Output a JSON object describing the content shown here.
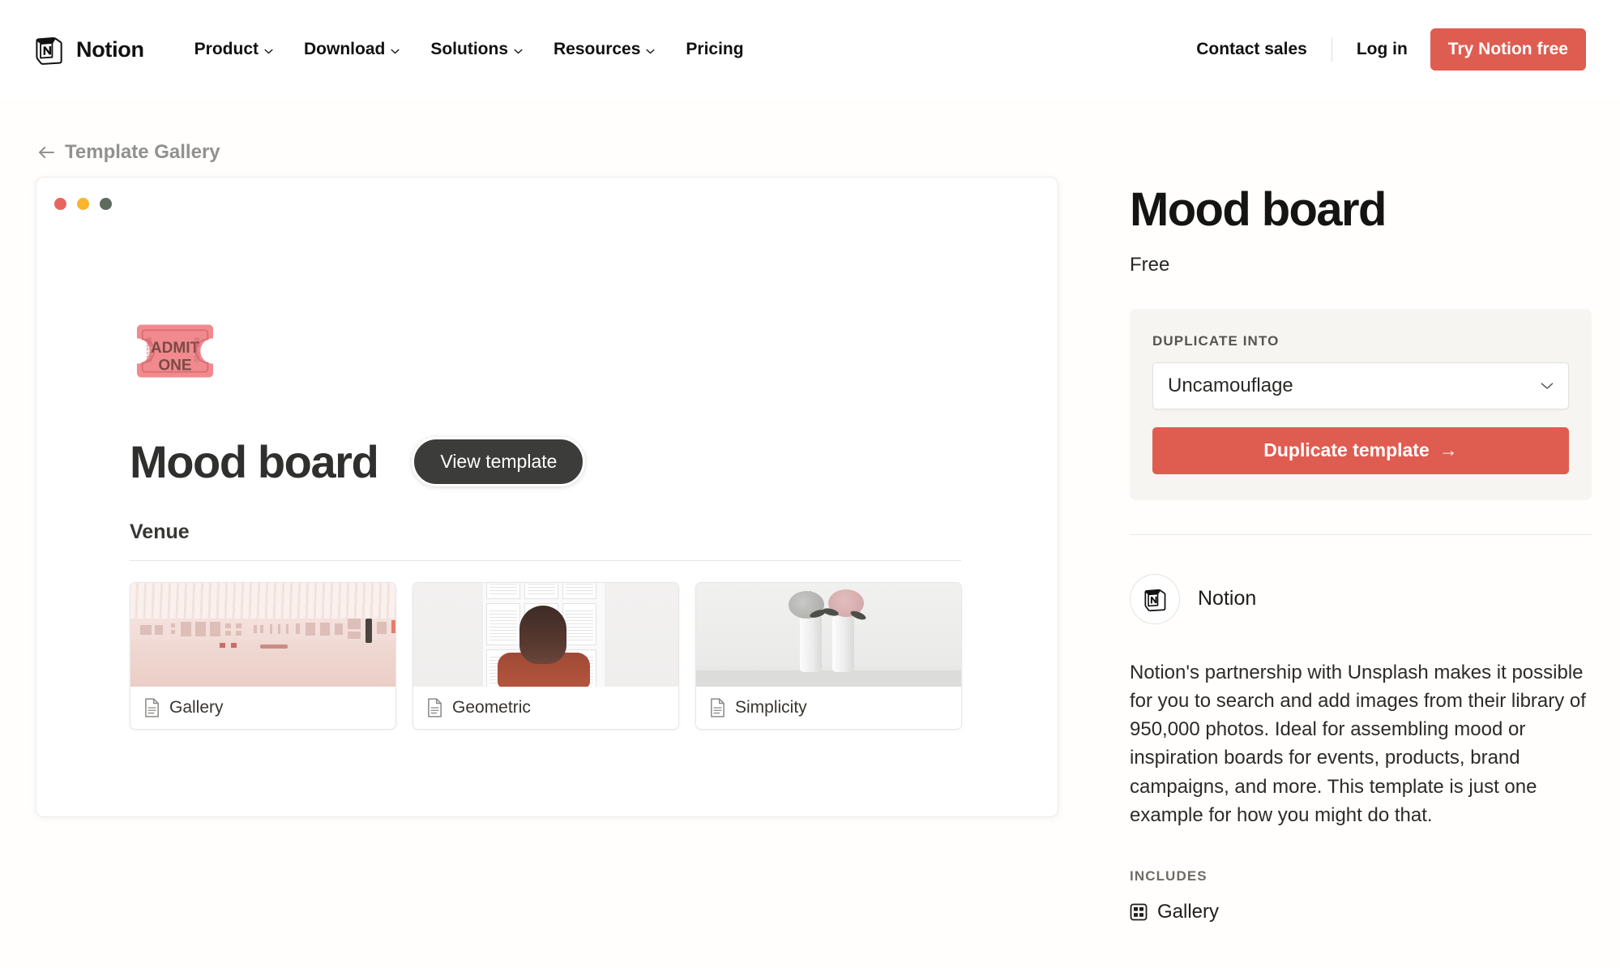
{
  "header": {
    "brand": "Notion",
    "nav": [
      {
        "label": "Product",
        "has_caret": true
      },
      {
        "label": "Download",
        "has_caret": true
      },
      {
        "label": "Solutions",
        "has_caret": true
      },
      {
        "label": "Resources",
        "has_caret": true
      },
      {
        "label": "Pricing",
        "has_caret": false
      }
    ],
    "contact_sales": "Contact sales",
    "log_in": "Log in",
    "cta": "Try Notion free",
    "cta_color": "#DF5C51"
  },
  "breadcrumb": {
    "label": "Template Gallery",
    "icon": "arrow-left-icon"
  },
  "preview": {
    "window_dots": [
      "#E8655F",
      "#F8B62C",
      "#5F6A5F"
    ],
    "emoji": "admission-ticket",
    "title": "Mood board",
    "view_button": "View template",
    "section_heading": "Venue",
    "cards": [
      {
        "label": "Gallery",
        "icon": "page-icon"
      },
      {
        "label": "Geometric",
        "icon": "page-icon"
      },
      {
        "label": "Simplicity",
        "icon": "page-icon"
      }
    ]
  },
  "sidebar": {
    "title": "Mood board",
    "price": "Free",
    "duplicate": {
      "label": "DUPLICATE INTO",
      "selected_workspace": "Uncamouflage",
      "button": "Duplicate template",
      "button_arrow": "→",
      "panel_bg": "#F7F5F1"
    },
    "author": {
      "name": "Notion",
      "avatar_icon": "notion-logo-icon"
    },
    "description": "Notion's partnership with Unsplash makes it possible for you to search and add images from their library of 950,000 photos. Ideal for assembling mood or inspiration boards for events, products, brand campaigns, and more. This template is just one example for how you might do that.",
    "includes": {
      "label": "INCLUDES",
      "items": [
        {
          "label": "Gallery",
          "icon": "gallery-grid-icon"
        }
      ]
    }
  }
}
